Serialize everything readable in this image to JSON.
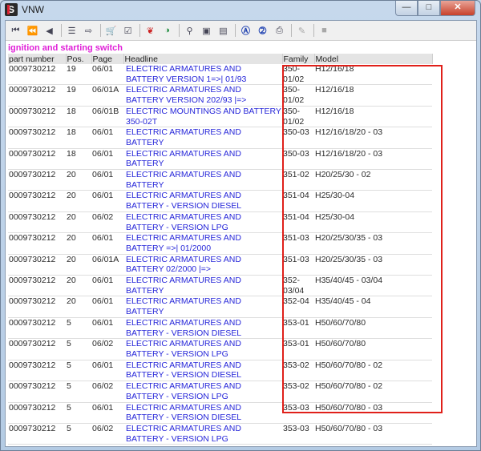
{
  "window": {
    "title": "VNW"
  },
  "section_title": "ignition and starting switch",
  "columns": [
    "part number",
    "Pos.",
    "Page",
    "Headline",
    "Family",
    "Model"
  ],
  "rows": [
    {
      "part": "0009730212",
      "pos": "19",
      "page": "06/01",
      "headline": "ELECTRIC ARMATURES AND BATTERY  VERSION 1=>| 01/93",
      "family": "350-01/02",
      "model": "H12/16/18"
    },
    {
      "part": "0009730212",
      "pos": "19",
      "page": "06/01A",
      "headline": "ELECTRIC ARMATURES AND BATTERY  VERSION 202/93 |=>",
      "family": "350-01/02",
      "model": "H12/16/18"
    },
    {
      "part": "0009730212",
      "pos": "18",
      "page": "06/01B",
      "headline": "ELECTRIC MOUNTINGS AND BATTERY 350-02T",
      "family": "350-01/02",
      "model": "H12/16/18"
    },
    {
      "part": "0009730212",
      "pos": "18",
      "page": "06/01",
      "headline": "ELECTRIC ARMATURES AND BATTERY",
      "family": "350-03",
      "model": "H12/16/18/20 - 03"
    },
    {
      "part": "0009730212",
      "pos": "18",
      "page": "06/01",
      "headline": "ELECTRIC ARMATURES AND BATTERY",
      "family": "350-03",
      "model": "H12/16/18/20 - 03"
    },
    {
      "part": "0009730212",
      "pos": "20",
      "page": "06/01",
      "headline": "ELECTRIC ARMATURES AND BATTERY",
      "family": "351-02",
      "model": "H20/25/30 - 02"
    },
    {
      "part": "0009730212",
      "pos": "20",
      "page": "06/01",
      "headline": "ELECTRIC ARMATURES AND BATTERY - VERSION DIESEL",
      "family": "351-04",
      "model": "H25/30-04"
    },
    {
      "part": "0009730212",
      "pos": "20",
      "page": "06/02",
      "headline": "ELECTRIC ARMATURES AND BATTERY - VERSION LPG",
      "family": "351-04",
      "model": "H25/30-04"
    },
    {
      "part": "0009730212",
      "pos": "20",
      "page": "06/01",
      "headline": "ELECTRIC ARMATURES AND BATTERY =>| 01/2000",
      "family": "351-03",
      "model": "H20/25/30/35 - 03"
    },
    {
      "part": "0009730212",
      "pos": "20",
      "page": "06/01A",
      "headline": "ELECTRIC ARMATURES AND BATTERY 02/2000 |=>",
      "family": "351-03",
      "model": "H20/25/30/35 - 03"
    },
    {
      "part": "0009730212",
      "pos": "20",
      "page": "06/01",
      "headline": "ELECTRIC ARMATURES AND BATTERY",
      "family": "352-03/04",
      "model": "H35/40/45 - 03/04"
    },
    {
      "part": "0009730212",
      "pos": "20",
      "page": "06/01",
      "headline": "ELECTRIC ARMATURES AND BATTERY",
      "family": "352-04",
      "model": "H35/40/45 - 04"
    },
    {
      "part": "0009730212",
      "pos": "5",
      "page": "06/01",
      "headline": "ELECTRIC ARMATURES AND BATTERY - VERSION DIESEL",
      "family": "353-01",
      "model": "H50/60/70/80"
    },
    {
      "part": "0009730212",
      "pos": "5",
      "page": "06/02",
      "headline": "ELECTRIC ARMATURES AND BATTERY - VERSION LPG",
      "family": "353-01",
      "model": "H50/60/70/80"
    },
    {
      "part": "0009730212",
      "pos": "5",
      "page": "06/01",
      "headline": "ELECTRIC ARMATURES AND BATTERY - VERSION DIESEL",
      "family": "353-02",
      "model": "H50/60/70/80 - 02"
    },
    {
      "part": "0009730212",
      "pos": "5",
      "page": "06/02",
      "headline": "ELECTRIC ARMATURES AND BATTERY - VERSION LPG",
      "family": "353-02",
      "model": "H50/60/70/80 - 02"
    },
    {
      "part": "0009730212",
      "pos": "5",
      "page": "06/01",
      "headline": "ELECTRIC ARMATURES AND BATTERY - VERSION DIESEL",
      "family": "353-03",
      "model": "H50/60/70/80 - 03"
    },
    {
      "part": "0009730212",
      "pos": "5",
      "page": "06/02",
      "headline": "ELECTRIC ARMATURES AND BATTERY - VERSION LPG",
      "family": "353-03",
      "model": "H50/60/70/80 - 03"
    }
  ],
  "toolbar_icons": [
    "first-icon",
    "back-icon",
    "prev-icon",
    "list-icon",
    "export-icon",
    "cart-icon",
    "checklist-icon",
    "tag-icon",
    "globe-icon",
    "zoom-icon",
    "page-icon",
    "page-copy-icon",
    "circle-a-icon",
    "circle-2-icon",
    "print-icon",
    "edit-icon",
    "stop-icon"
  ],
  "colors": {
    "headline_link": "#2626d9",
    "section_title": "#e020d8",
    "annotation_border": "#e0201a"
  }
}
